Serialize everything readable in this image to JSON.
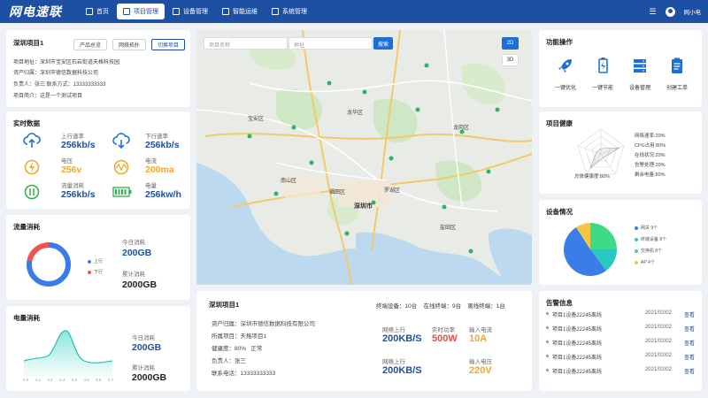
{
  "app": {
    "logo": "网电速联",
    "user": "网小电"
  },
  "nav": [
    {
      "label": "首页"
    },
    {
      "label": "项目管理"
    },
    {
      "label": "设备管理"
    },
    {
      "label": "智能运维"
    },
    {
      "label": "系统管理"
    }
  ],
  "project": {
    "title": "深圳项目1",
    "tabs": [
      "产品总览",
      "网络拓扑",
      "切换项目"
    ],
    "address": "项目地址：深圳市宝安区石岩街道天格科技园",
    "owner": "资产归属：深圳市德信数据科技公司",
    "contact": "负责人：张三    联系方式：13333333333",
    "intro": "项目简介：这是一个测试项目"
  },
  "realtime": {
    "title": "实时数据",
    "items": [
      {
        "label": "上行速率",
        "value": "256kb/s"
      },
      {
        "label": "下行速率",
        "value": "256kb/s"
      },
      {
        "label": "电压",
        "value": "256v"
      },
      {
        "label": "电流",
        "value": "200ma"
      },
      {
        "label": "流量消耗",
        "value": "256kb/s"
      },
      {
        "label": "电量",
        "value": "256kw/h"
      }
    ]
  },
  "traffic": {
    "title": "流量消耗",
    "legend_up": "上行",
    "legend_down": "下行",
    "today_label": "今日消耗",
    "today_value": "200GB",
    "total_label": "累计消耗",
    "total_value": "2000GB",
    "share_up": 0.78
  },
  "power": {
    "title": "电量消耗",
    "today_label": "今日消耗",
    "today_value": "200GB",
    "total_label": "累计消耗",
    "total_value": "2000GB",
    "x_ticks": [
      "4.0",
      "4.1",
      "4.2",
      "4.3",
      "4.4",
      "4.5",
      "4.6",
      "4.7"
    ]
  },
  "map": {
    "search_placeholder": "项目名称",
    "address_placeholder": "地址",
    "search_button": "搜索",
    "btn_2d": "2D",
    "btn_3d": "3D",
    "labels": [
      "宝安区",
      "龙华区",
      "南山区",
      "福田区",
      "深圳市",
      "罗湖区",
      "龙岗区",
      "盐田区"
    ]
  },
  "detail": {
    "title": "深圳项目1",
    "terminals": "终端设备：10台    在线终端：9台    离线终端：1台",
    "owner": "资产归属：深圳市德信数据科技有限公司",
    "project": "所属项目：天格项目1",
    "health": "健康度：80%   正常",
    "manager": "负责人：张三",
    "phone": "联系电话：13333333333",
    "m1_label": "网络上行",
    "m1_value": "200KB/S",
    "m2_label": "实时功率",
    "m2_value": "500W",
    "m3_label": "输入电流",
    "m3_value": "10A",
    "m4_label": "网络上行",
    "m4_value": "200KB/S",
    "m5_label": "输入电压",
    "m5_value": "220V"
  },
  "functions": {
    "title": "功能操作",
    "items": [
      "一键优化",
      "一键节能",
      "设备管理",
      "创建工单"
    ]
  },
  "health": {
    "title": "项目健康",
    "center_label": "总体健康度:80%",
    "items": [
      "网络速率:20%",
      "CPU占用:80%",
      "在线状况:20%",
      "告警处理:20%",
      "剩余电量:80%"
    ]
  },
  "devices": {
    "title": "设备情况",
    "legend": [
      "网关 9个",
      "终端设备 8个",
      "交换机 8个",
      "AP 4个"
    ],
    "colors": [
      "#3a7de8",
      "#28c9c0",
      "#3ddc84",
      "#f5c542"
    ]
  },
  "alarms": {
    "title": "告警信息",
    "rows": [
      {
        "text": "项目1设备22245离线",
        "date": "2021/02/02",
        "action": "查看"
      },
      {
        "text": "项目1设备22245离线",
        "date": "2021/02/02",
        "action": "查看"
      },
      {
        "text": "项目1设备22245离线",
        "date": "2021/02/02",
        "action": "查看"
      },
      {
        "text": "项目1设备22245离线",
        "date": "2021/02/02",
        "action": "查看"
      },
      {
        "text": "项目1设备22245离线",
        "date": "2021/02/02",
        "action": "查看"
      }
    ]
  }
}
